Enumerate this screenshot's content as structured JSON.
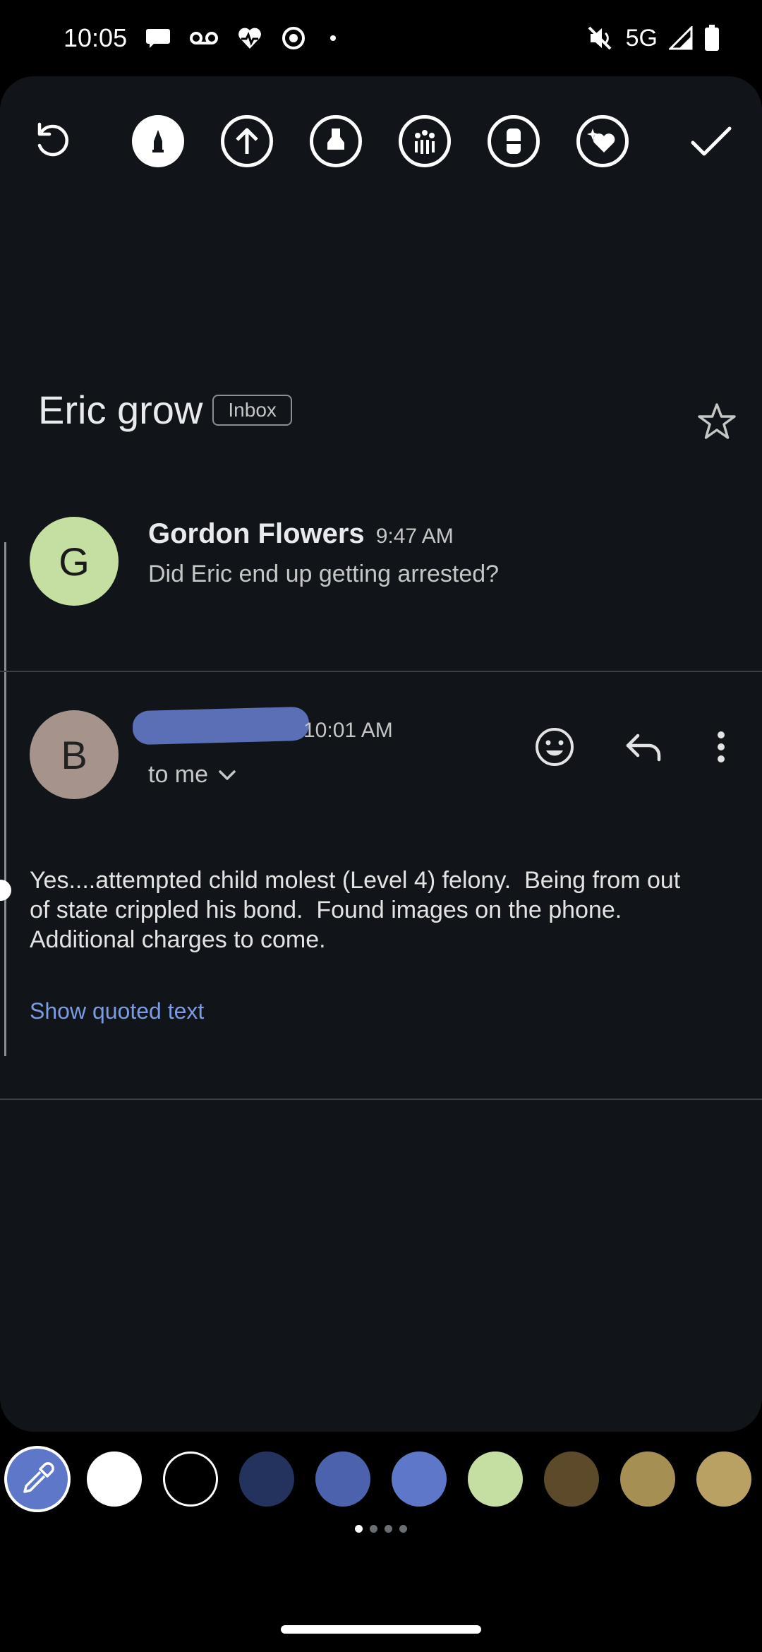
{
  "status_bar": {
    "time": "10:05",
    "network": "5G",
    "left_icons": [
      "chat-bubble-icon",
      "voicemail-icon",
      "health-heart-icon",
      "record-icon",
      "dot-icon"
    ],
    "right_icons": [
      "mute-icon",
      "signal-icon",
      "battery-icon"
    ]
  },
  "toolbar": {
    "tools": [
      "undo-icon",
      "pen-icon",
      "arrow-icon",
      "highlighter-icon",
      "palette-icon",
      "eraser-icon",
      "sticker-icon",
      "done-icon"
    ]
  },
  "email": {
    "subject": "Eric grow",
    "label": "Inbox",
    "messages": [
      {
        "avatar_letter": "G",
        "sender": "Gordon Flowers",
        "time": "9:47 AM",
        "snippet": "Did Eric end up getting arrested?"
      },
      {
        "avatar_letter": "B",
        "time": "10:01 AM",
        "recipient": "to me",
        "body_lines": [
          "Yes....attempted child molest (Level 4) felony.  Being from out",
          "of state crippled his bond.  Found images on the phone.",
          "Additional charges to come."
        ],
        "show_quoted": "Show quoted text"
      }
    ]
  },
  "palette": {
    "colors": [
      "#ffffff",
      "#000000",
      "#24335e",
      "#4d62ad",
      "#5e77c8",
      "#c5dea1",
      "#5c4a2a",
      "#a68f52",
      "#b8a163"
    ],
    "selected_tool": "eyedropper-icon"
  }
}
